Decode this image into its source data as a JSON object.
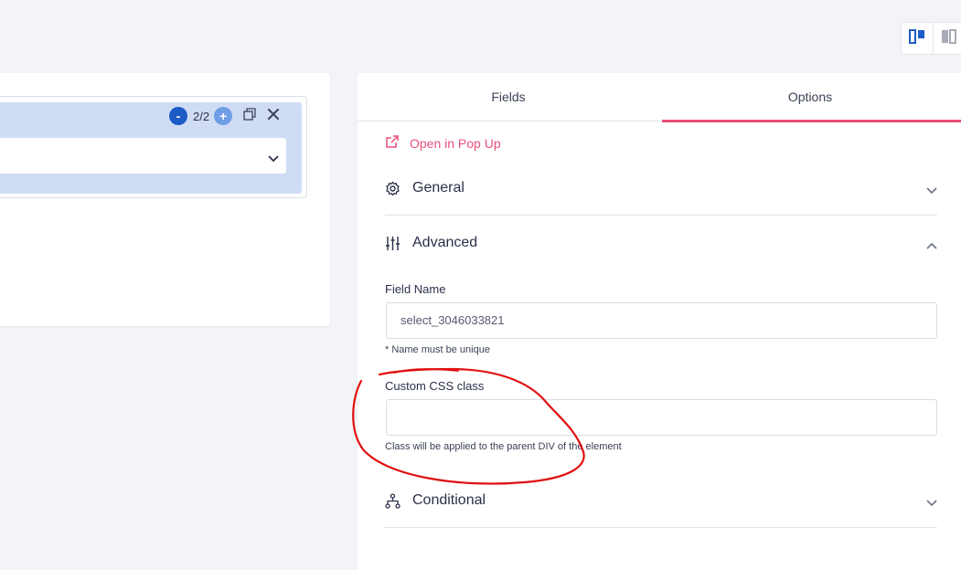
{
  "layout_toggle": {
    "icons": [
      "split-view-icon",
      "panel-view-icon"
    ]
  },
  "canvas": {
    "counter": "2/2",
    "minus_symbol": "-",
    "plus_symbol": "+"
  },
  "tabs": [
    {
      "label": "Fields",
      "active": false
    },
    {
      "label": "Options",
      "active": true
    }
  ],
  "popup_link": "Open in Pop Up",
  "sections": {
    "general": "General",
    "advanced": "Advanced",
    "conditional": "Conditional"
  },
  "advanced": {
    "field_name_label": "Field Name",
    "field_name_value": "select_3046033821",
    "field_name_help": "* Name must be unique",
    "css_class_label": "Custom CSS class",
    "css_class_value": "",
    "css_class_help": "Class will be applied to the parent DIV of the element"
  },
  "colors": {
    "accent_pink": "#e8517a",
    "primary_blue": "#1d5bc6",
    "annotation_red": "#e01010"
  }
}
